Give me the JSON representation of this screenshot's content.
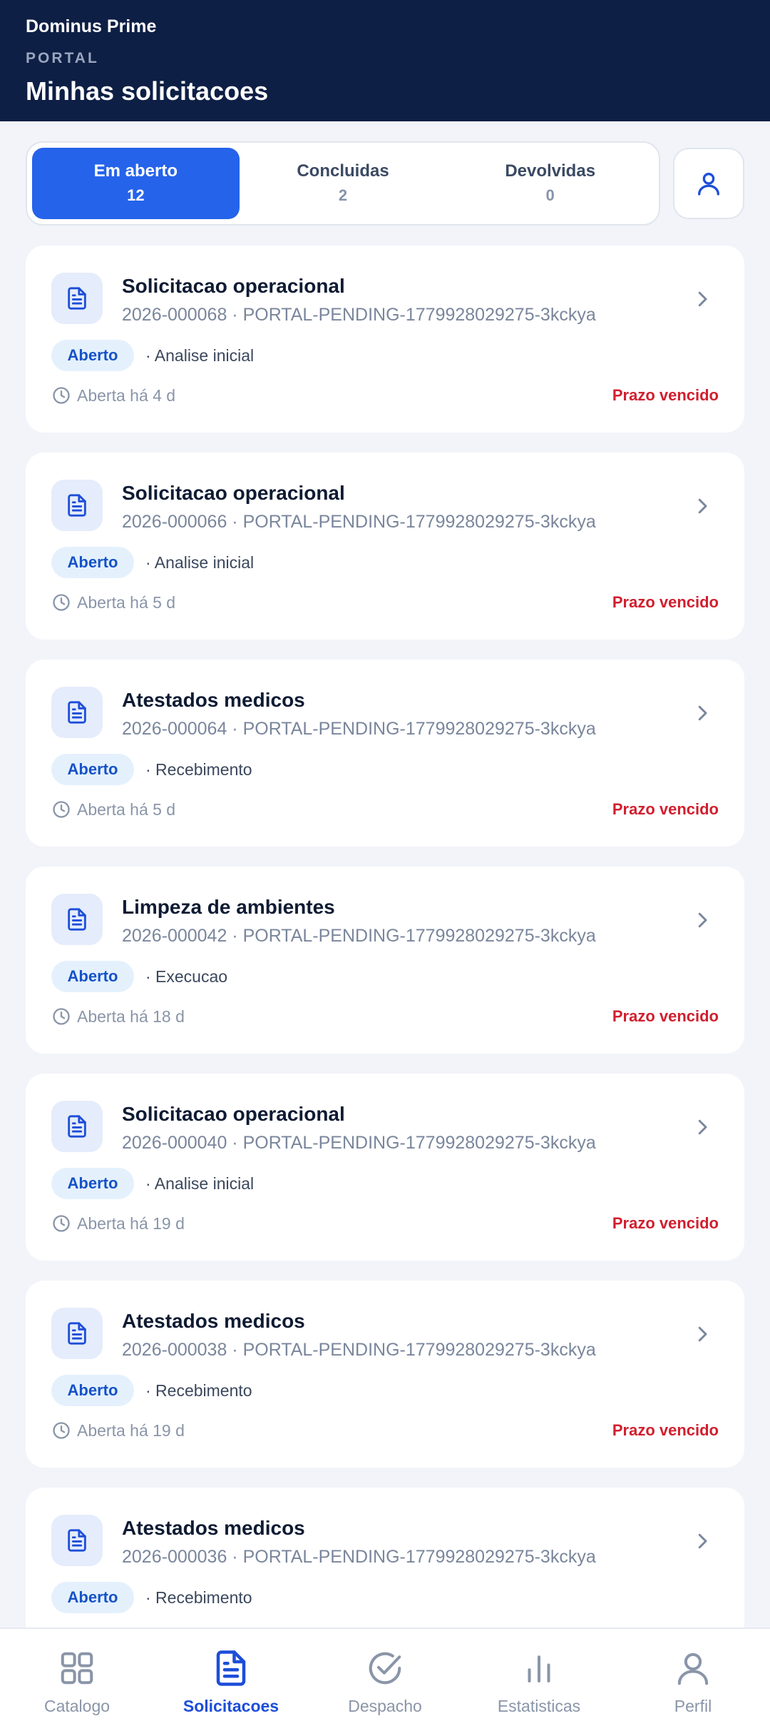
{
  "header": {
    "brand": "Dominus Prime",
    "section": "PORTAL",
    "title": "Minhas solicitacoes"
  },
  "tabs": [
    {
      "label": "Em aberto",
      "count": "12",
      "active": true
    },
    {
      "label": "Concluidas",
      "count": "2",
      "active": false
    },
    {
      "label": "Devolvidas",
      "count": "0",
      "active": false
    }
  ],
  "requests": [
    {
      "title": "Solicitacao operacional",
      "subtitle": "2026-000068 · PORTAL-PENDING-1779928029275-3kckya",
      "status": "Aberto",
      "stage": "· Analise inicial",
      "age": "Aberta há 4 d",
      "deadline": "Prazo vencido"
    },
    {
      "title": "Solicitacao operacional",
      "subtitle": "2026-000066 · PORTAL-PENDING-1779928029275-3kckya",
      "status": "Aberto",
      "stage": "· Analise inicial",
      "age": "Aberta há 5 d",
      "deadline": "Prazo vencido"
    },
    {
      "title": "Atestados medicos",
      "subtitle": "2026-000064 · PORTAL-PENDING-1779928029275-3kckya",
      "status": "Aberto",
      "stage": "· Recebimento",
      "age": "Aberta há 5 d",
      "deadline": "Prazo vencido"
    },
    {
      "title": "Limpeza de ambientes",
      "subtitle": "2026-000042 · PORTAL-PENDING-1779928029275-3kckya",
      "status": "Aberto",
      "stage": "· Execucao",
      "age": "Aberta há 18 d",
      "deadline": "Prazo vencido"
    },
    {
      "title": "Solicitacao operacional",
      "subtitle": "2026-000040 · PORTAL-PENDING-1779928029275-3kckya",
      "status": "Aberto",
      "stage": "· Analise inicial",
      "age": "Aberta há 19 d",
      "deadline": "Prazo vencido"
    },
    {
      "title": "Atestados medicos",
      "subtitle": "2026-000038 · PORTAL-PENDING-1779928029275-3kckya",
      "status": "Aberto",
      "stage": "· Recebimento",
      "age": "Aberta há 19 d",
      "deadline": "Prazo vencido"
    },
    {
      "title": "Atestados medicos",
      "subtitle": "2026-000036 · PORTAL-PENDING-1779928029275-3kckya",
      "status": "Aberto",
      "stage": "· Recebimento",
      "age": "",
      "deadline": ""
    }
  ],
  "nav": [
    {
      "label": "Catalogo",
      "icon": "grid-icon",
      "active": false
    },
    {
      "label": "Solicitacoes",
      "icon": "document-icon",
      "active": true
    },
    {
      "label": "Despacho",
      "icon": "check-circle-icon",
      "active": false
    },
    {
      "label": "Estatisticas",
      "icon": "bar-chart-icon",
      "active": false
    },
    {
      "label": "Perfil",
      "icon": "person-icon",
      "active": false
    }
  ],
  "colors": {
    "header_bg": "#0e1f45",
    "accent": "#2563eb",
    "badge_bg": "#e4f1fd",
    "overdue": "#d11f2e"
  }
}
